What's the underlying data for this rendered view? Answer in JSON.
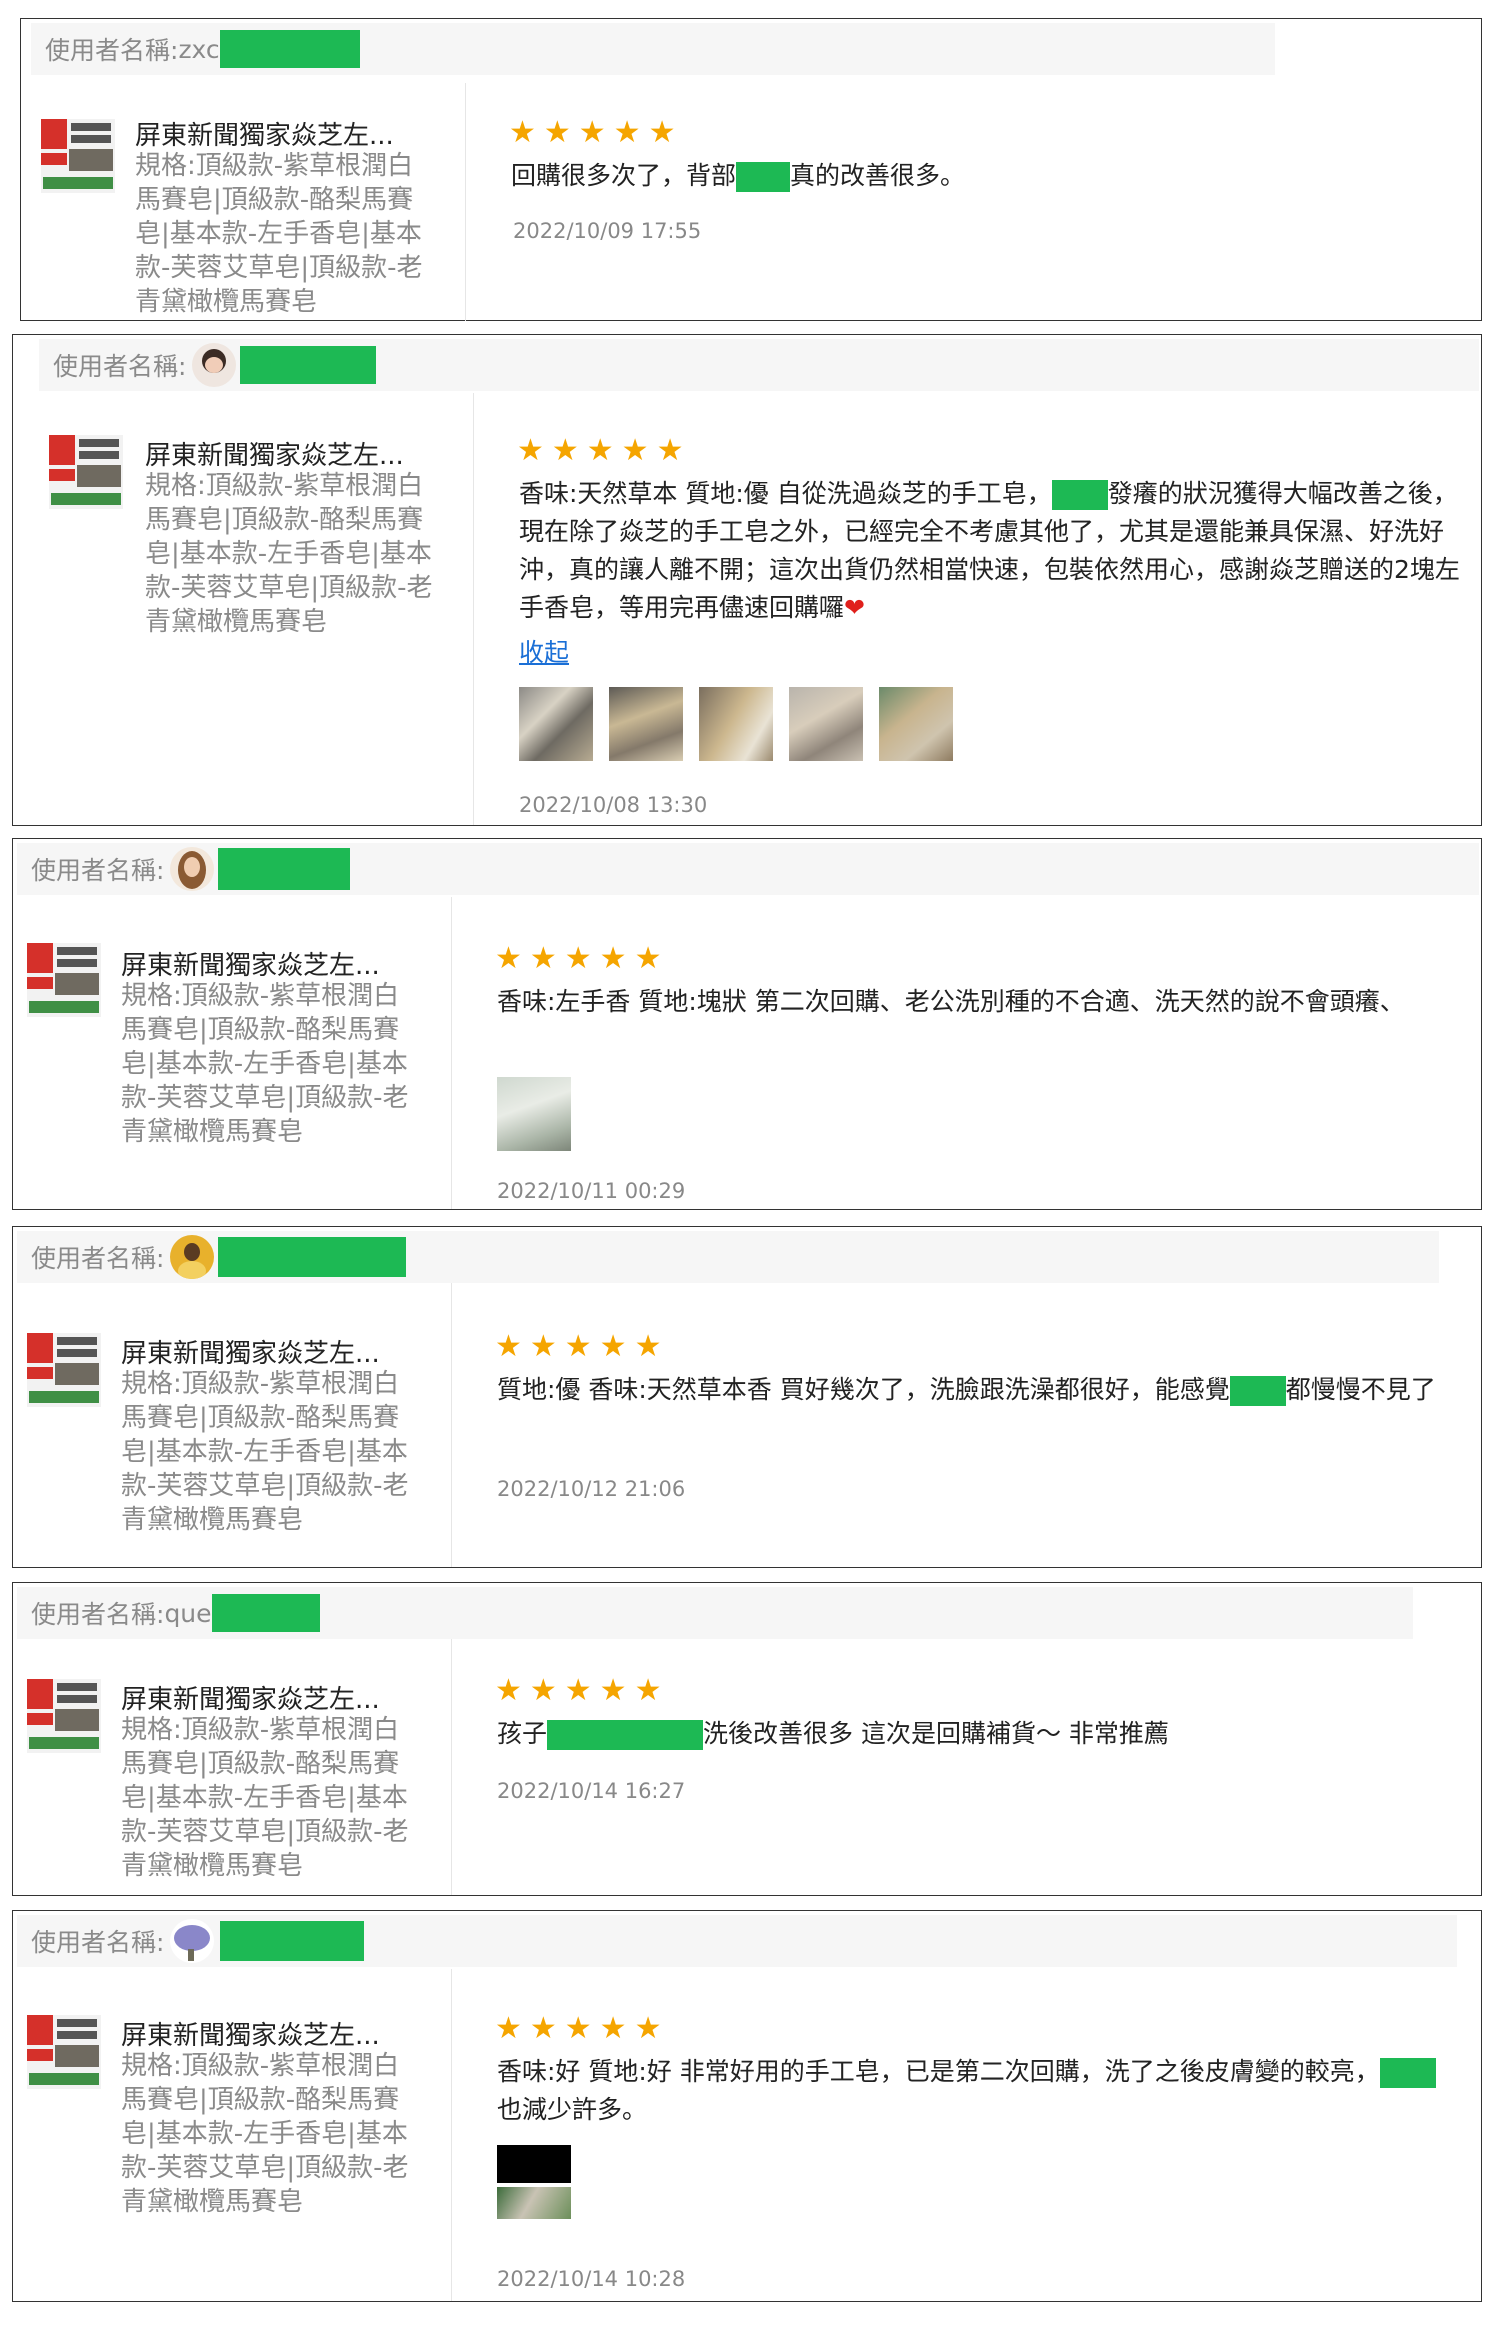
{
  "product": {
    "title": "屏東新聞獨家焱芝左...",
    "spec": "規格:頂級款-紫草根潤白馬賽皂|頂級款-酪梨馬賽皂|基本款-左手香皂|基本款-芙蓉艾草皂|頂級款-老青黛橄欖馬賽皂"
  },
  "stars": "★★★★★",
  "reviews": [
    {
      "user_label": "使用者名稱:",
      "user_prefix": "zxc",
      "text_parts": [
        "回購很多次了，背部",
        "真的改善很多。"
      ],
      "date": "2022/10/09 17:55"
    },
    {
      "user_label": "使用者名稱:",
      "text_parts": [
        "香味:天然草本 質地:優 自從洗過焱芝的手工皂，",
        "發癢的狀況獲得大幅改善之後，現在除了焱芝的手工皂之外，已經完全不考慮其他了，尤其是還能兼具保濕、好洗好沖，真的讓人離不開；這次出貨仍然相當快速，包裝依然用心，感謝焱芝贈送的2塊左手香皂，等用完再儘速回購囉"
      ],
      "heart": "❤",
      "collapse": "收起",
      "date": "2022/10/08 13:30"
    },
    {
      "user_label": "使用者名稱:",
      "text_parts": [
        "香味:左手香 質地:塊狀 第二次回購、老公洗別種的不合適、洗天然的說不會頭癢、"
      ],
      "date": "2022/10/11 00:29"
    },
    {
      "user_label": "使用者名稱:",
      "text_parts": [
        "質地:優 香味:天然草本香 買好幾次了，洗臉跟洗澡都很好，能感覺",
        "都慢慢不見了"
      ],
      "date": "2022/10/12 21:06"
    },
    {
      "user_label": "使用者名稱:",
      "user_prefix": "que",
      "text_parts": [
        "孩子",
        "洗後改善很多 這次是回購補貨～ 非常推薦"
      ],
      "date": "2022/10/14 16:27"
    },
    {
      "user_label": "使用者名稱:",
      "text_parts": [
        "香味:好 質地:好 非常好用的手工皂，已是第二次回購，洗了之後皮膚變的較亮，",
        "也減少許多。"
      ],
      "date": "2022/10/14 10:28"
    }
  ],
  "colors": {
    "star": "#f5a500",
    "redaction": "#1db954",
    "link": "#1a6fd6",
    "heart": "#e0201c"
  }
}
